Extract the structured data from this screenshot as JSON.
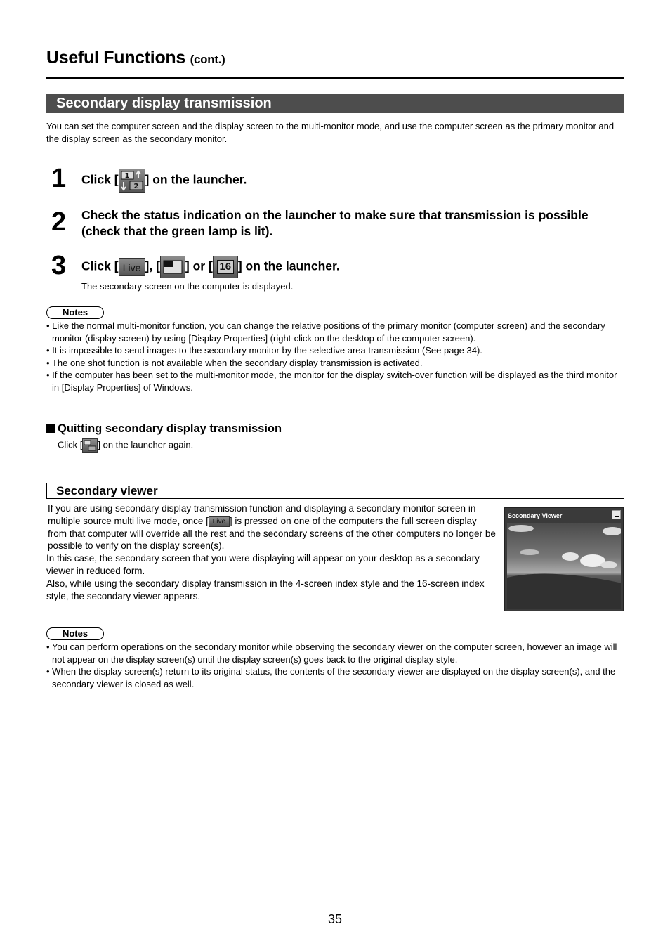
{
  "header": {
    "title": "Useful Functions",
    "title_suffix": "(cont.)"
  },
  "section": {
    "title": "Secondary display transmission",
    "intro": "You can set the computer screen and the display screen to the multi-monitor mode, and use the computer screen as the primary monitor and the display screen as the secondary monitor."
  },
  "steps": [
    {
      "number": "1",
      "prefix": "Click [",
      "icon": "secondary-display-icon",
      "suffix": "] on the launcher."
    },
    {
      "number": "2",
      "text": "Check the status indication on the launcher to make sure that transmission is possible (check that the green lamp is lit)."
    },
    {
      "number": "3",
      "prefix": "Click [",
      "icons": [
        "live-icon",
        "4-screen-index-icon",
        "16-screen-index-icon"
      ],
      "sep1": "], [",
      "sep2": "] or [",
      "suffix": "] on the launcher.",
      "sub": "The secondary screen on the computer is displayed.",
      "live_label": "Live",
      "sixteen_label": "16"
    }
  ],
  "notes1": {
    "label": "Notes",
    "items": [
      "Like the normal multi-monitor function, you can change the relative positions of the primary monitor (computer screen) and the secondary monitor (display screen) by using [Display Properties] (right-click on the desktop of the computer screen).",
      "It is impossible to send images to the secondary monitor by the selective area transmission (See page 34).",
      "The one shot function is not available when the secondary display transmission is activated.",
      "If the computer has been set to the multi-monitor mode, the monitor for the display switch-over function will be displayed as the third monitor in [Display Properties] of Windows."
    ]
  },
  "quitting": {
    "title": "Quitting secondary display transmission",
    "prefix": "Click [",
    "suffix": "] on the launcher again."
  },
  "viewer_section": {
    "title": "Secondary viewer",
    "p1_a": "If you are using secondary display transmission function and displaying a secondary monitor screen in multiple source multi live mode, once [",
    "p1_b": "] is pressed on one of the computers the full screen display from that computer will override all the rest and the secondary screens of the other computers no longer be possible to verify on the display screen(s).",
    "p2": "In this case, the secondary screen that you were displaying will appear on your desktop as a secondary viewer in reduced form.",
    "p3": "Also, while using the secondary display transmission in the 4-screen index style and the 16-screen index style, the secondary viewer appears.",
    "live_label": "Live",
    "window_title": "Secondary Viewer"
  },
  "notes2": {
    "label": "Notes",
    "items": [
      "You can perform operations on the secondary monitor while observing the secondary viewer on the computer screen, however an image will not appear on the display screen(s) until the display screen(s) goes back to the original display style.",
      "When the display screen(s) return to its original status, the contents of the secondary viewer are displayed on the display screen(s), and the secondary viewer is closed as well."
    ]
  },
  "page_number": "35"
}
